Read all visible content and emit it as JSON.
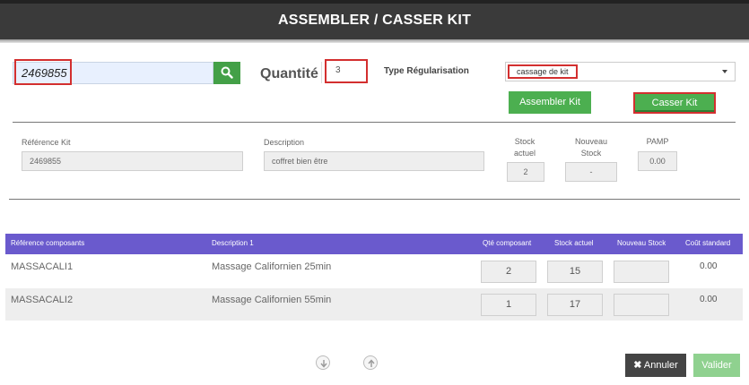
{
  "header": {
    "title": "ASSEMBLER / CASSER KIT"
  },
  "search": {
    "value": "2469855",
    "icon": "search-icon"
  },
  "quantity": {
    "label": "Quantité",
    "value": "3"
  },
  "regularisation": {
    "label": "Type Régularisation",
    "selected": "cassage de kit"
  },
  "actions": {
    "assembler_label": "Assembler Kit",
    "casser_label": "Casser Kit"
  },
  "kit": {
    "reference_label": "Référence Kit",
    "reference_value": "2469855",
    "description_label": "Description",
    "description_value": "coffret bien être",
    "stock_actuel_label_1": "Stock",
    "stock_actuel_label_2": "actuel",
    "stock_actuel_value": "2",
    "nouveau_stock_label_1": "Nouveau",
    "nouveau_stock_label_2": "Stock",
    "nouveau_stock_value": "-",
    "pamp_label": "PAMP",
    "pamp_value": "0.00"
  },
  "table": {
    "headers": [
      "Référence composants",
      "Description 1",
      "Qté composant",
      "Stock actuel",
      "Nouveau Stock",
      "Coût standard"
    ],
    "rows": [
      {
        "reference": "MASSACALI1",
        "description": "Massage Californien 25min",
        "qte": "2",
        "stock": "15",
        "nouveau": "",
        "cout": "0.00"
      },
      {
        "reference": "MASSACALI2",
        "description": "Massage Californien 55min",
        "qte": "1",
        "stock": "17",
        "nouveau": "",
        "cout": "0.00"
      }
    ]
  },
  "footer": {
    "annuler_label": "Annuler",
    "valider_label": "Valider"
  },
  "colors": {
    "header_bg": "#3a3a3a",
    "green": "#4caf50",
    "table_header": "#6a5acd",
    "highlight": "#d32f2f"
  }
}
